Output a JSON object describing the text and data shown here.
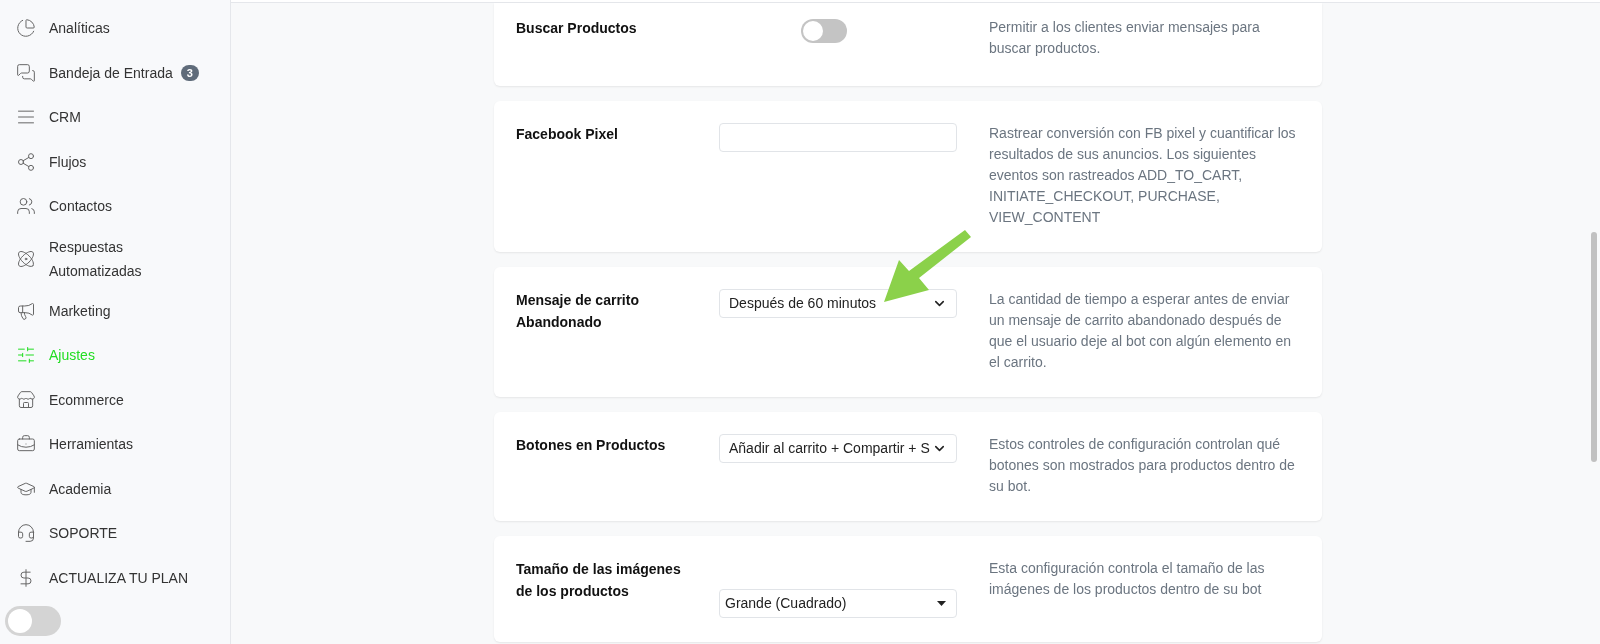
{
  "sidebar": {
    "items": [
      {
        "label": "Analíticas",
        "selected": false
      },
      {
        "label": "Bandeja de Entrada",
        "selected": false,
        "badge": "3"
      },
      {
        "label": "CRM",
        "selected": false
      },
      {
        "label": "Flujos",
        "selected": false
      },
      {
        "label": "Contactos",
        "selected": false
      },
      {
        "label": "Respuestas Automatizadas",
        "selected": false
      },
      {
        "label": "Marketing",
        "selected": false
      },
      {
        "label": "Ajustes",
        "selected": true
      },
      {
        "label": "Ecommerce",
        "selected": false
      },
      {
        "label": "Herramientas",
        "selected": false
      },
      {
        "label": "Academia",
        "selected": false
      },
      {
        "label": "SOPORTE",
        "selected": false
      },
      {
        "label": "ACTUALIZA TU PLAN",
        "selected": false
      }
    ],
    "toggle": {
      "on": false
    }
  },
  "settings": [
    {
      "kind": "toggle",
      "label": "Buscar Productos",
      "on": false,
      "description": "Permitir a los clientes enviar mensajes para buscar productos."
    },
    {
      "kind": "input",
      "label": "Facebook Pixel",
      "description": "Rastrear conversión con FB pixel y cuantificar los resultados de sus anuncios. Los siguientes eventos son rastreados ADD_TO_CART, INITIATE_CHECKOUT, PURCHASE, VIEW_CONTENT"
    },
    {
      "kind": "select",
      "label": "Mensaje de carrito Abandonado",
      "value": "Después de 60 minutos",
      "description": "La cantidad de tiempo a esperar antes de enviar un mensaje de carrito abandonado después de que el usuario deje al bot con algún elemento en el carrito."
    },
    {
      "kind": "select",
      "label": "Botones en Productos",
      "value": "Añadir al carrito + Compartir + S",
      "description": "Estos controles de configuración controlan qué botones son mostrados para productos dentro de su bot."
    },
    {
      "kind": "native_select",
      "label": "Tamaño de las imágenes de los productos",
      "value": "Grande (Cuadrado)",
      "description": "Esta configuración controla el tamaño de las imágenes de los productos dentro de su bot"
    }
  ]
}
